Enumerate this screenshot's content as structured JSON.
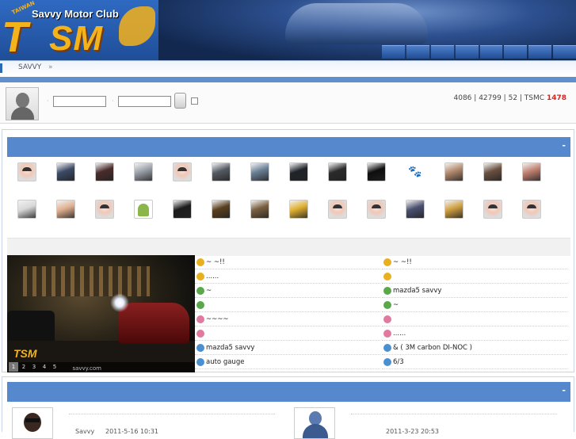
{
  "brand": {
    "badge": "TAIWAN",
    "club_name": "Savvy Motor Club",
    "wordmark_t": "T",
    "wordmark_sm": "SM"
  },
  "breadcrumb": {
    "item": "SAVVY",
    "separator": "»"
  },
  "login": {
    "username_value": "",
    "password_value": "",
    "stats_members": "4086 |",
    "stats_topics": "42799 |",
    "stats_online": "52 | TSMC",
    "stats_highlight": "1478"
  },
  "sections": {
    "collapse_symbol": "-"
  },
  "member_thumbs": [
    {
      "kind": "default-avatar",
      "color": "#e8a0a0"
    },
    {
      "kind": "car-wheel",
      "color": "#3b4a66"
    },
    {
      "kind": "couple-photo",
      "color": "#4a2b2b"
    },
    {
      "kind": "silver-car",
      "color": "#9aa0a8"
    },
    {
      "kind": "default-avatar",
      "color": "#e8a0a0"
    },
    {
      "kind": "car-photo",
      "color": "#555b63"
    },
    {
      "kind": "car-photo",
      "color": "#6a7f95"
    },
    {
      "kind": "dark-car",
      "color": "#20242a"
    },
    {
      "kind": "night-car",
      "color": "#2a2a2a"
    },
    {
      "kind": "black-car",
      "color": "#0e0e0e"
    },
    {
      "kind": "paw-print",
      "color": "#ffffff"
    },
    {
      "kind": "person-photo",
      "color": "#b38a6e"
    },
    {
      "kind": "person-photo",
      "color": "#6a5040"
    },
    {
      "kind": "person-photo",
      "color": "#c08070"
    },
    {
      "kind": "white-car",
      "color": "#d8d8d8"
    },
    {
      "kind": "baby-photo",
      "color": "#e0b090"
    },
    {
      "kind": "default-avatar",
      "color": "#e8a0a0"
    },
    {
      "kind": "android-robot",
      "color": "#8ab64a"
    },
    {
      "kind": "dark-figure",
      "color": "#1c1c1c"
    },
    {
      "kind": "rear-car",
      "color": "#5a4020"
    },
    {
      "kind": "cartoon-face",
      "color": "#7a6040"
    },
    {
      "kind": "cartoon-character",
      "color": "#e0b030"
    },
    {
      "kind": "default-avatar",
      "color": "#e8a0a0"
    },
    {
      "kind": "default-avatar",
      "color": "#e8a0a0"
    },
    {
      "kind": "group-photo",
      "color": "#4a5070"
    },
    {
      "kind": "child-photo",
      "color": "#d0a040"
    },
    {
      "kind": "default-avatar",
      "color": "#e8a0a0"
    },
    {
      "kind": "default-avatar",
      "color": "#e8a0a0"
    }
  ],
  "slideshow": {
    "pages": [
      "1",
      "2",
      "3",
      "4",
      "5"
    ],
    "active_page": "1",
    "watermark": "savvy.com"
  },
  "topics_left": [
    {
      "text": "~ ~!!",
      "icon_color": "#e8b020"
    },
    {
      "text": "......",
      "icon_color": "#e8b020"
    },
    {
      "text": "~",
      "icon_color": "#5aa84a"
    },
    {
      "text": "",
      "icon_color": "#5aa84a"
    },
    {
      "text": "~~~~",
      "icon_color": "#e07aa0"
    },
    {
      "text": "",
      "icon_color": "#e07aa0"
    },
    {
      "text": "mazda5 savvy",
      "icon_color": "#4a90d0"
    },
    {
      "text": "auto gauge",
      "icon_color": "#4a90d0"
    }
  ],
  "topics_right": [
    {
      "text": "~ ~!!",
      "icon_color": "#e8b020"
    },
    {
      "text": "",
      "icon_color": "#e8b020"
    },
    {
      "text": "mazda5 savvy",
      "icon_color": "#5aa84a"
    },
    {
      "text": "~",
      "icon_color": "#5aa84a"
    },
    {
      "text": "",
      "icon_color": "#e07aa0"
    },
    {
      "text": "......",
      "icon_color": "#e07aa0"
    },
    {
      "text": "&    (  3M carbon DI-NOC )",
      "icon_color": "#4a90d0"
    },
    {
      "text": "6/3",
      "icon_color": "#4a90d0"
    }
  ],
  "featured_members": [
    {
      "kind": "person-sunglasses",
      "name": "Savvy",
      "time": "2011-5-16 10:31"
    },
    {
      "kind": "blue-figure",
      "name": "",
      "time": "2011-3-23 20:53"
    }
  ],
  "colors": {
    "section_header": "#5588cc",
    "brand_gold": "#f4b21b",
    "stat_highlight": "#dd2222"
  }
}
